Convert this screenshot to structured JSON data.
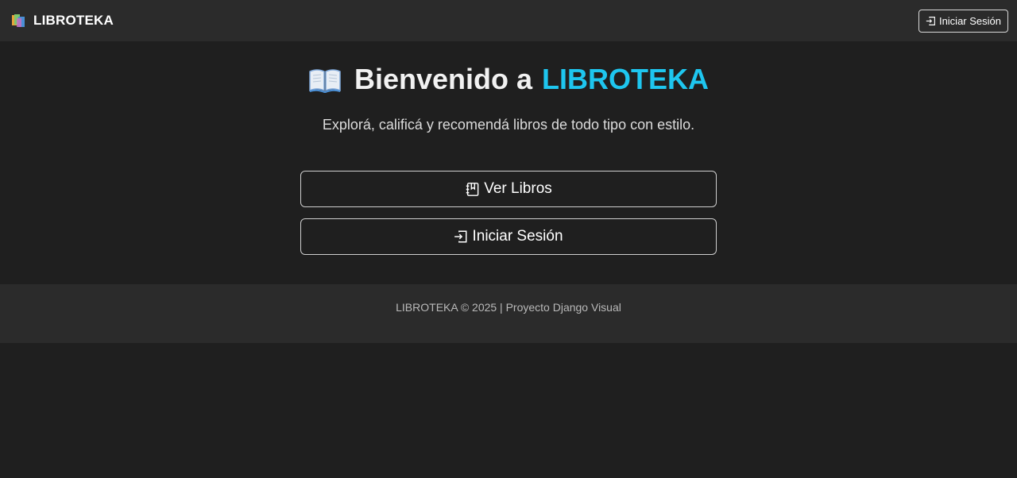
{
  "navbar": {
    "brand": "LIBROTEKA",
    "brand_icon": "books-icon",
    "login_label": "Iniciar Sesión",
    "login_icon": "login-icon"
  },
  "hero": {
    "title_prefix": "Bienvenido a",
    "title_brand": "LIBROTEKA",
    "title_icon": "open-book-icon",
    "subtitle": "Explorá, calificá y recomendá libros de todo tipo con estilo."
  },
  "actions": {
    "books_label": "Ver Libros",
    "books_icon": "journal-icon",
    "login_label": "Iniciar Sesión",
    "login_icon": "login-icon"
  },
  "footer": {
    "text": "LIBROTEKA © 2025 | Proyecto Django Visual"
  },
  "colors": {
    "background": "#1f1f1f",
    "navbar": "#2b2b2b",
    "accent": "#1ec6ef"
  }
}
